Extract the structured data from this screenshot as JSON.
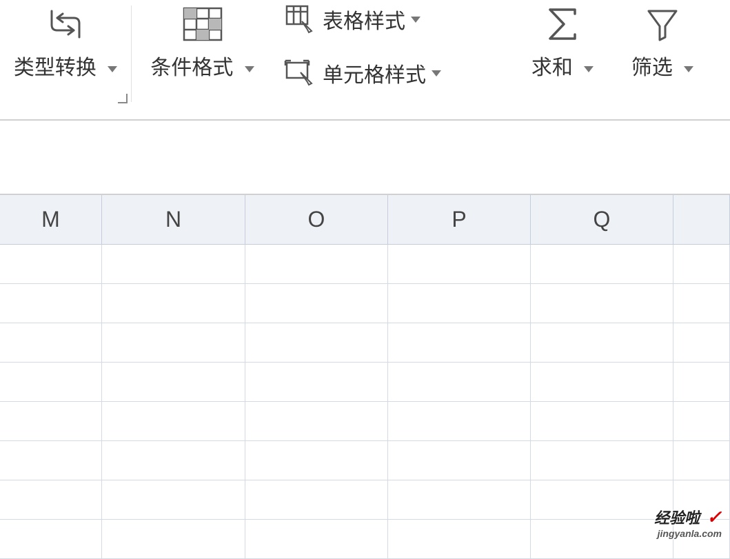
{
  "ribbon": {
    "type_convert": "类型转换",
    "conditional_format": "条件格式",
    "table_style": "表格样式",
    "cell_style": "单元格样式",
    "sum": "求和",
    "filter": "筛选"
  },
  "columns": [
    "M",
    "N",
    "O",
    "P",
    "Q",
    ""
  ],
  "watermark": {
    "title": "经验啦",
    "url": "jingyanla.com"
  }
}
